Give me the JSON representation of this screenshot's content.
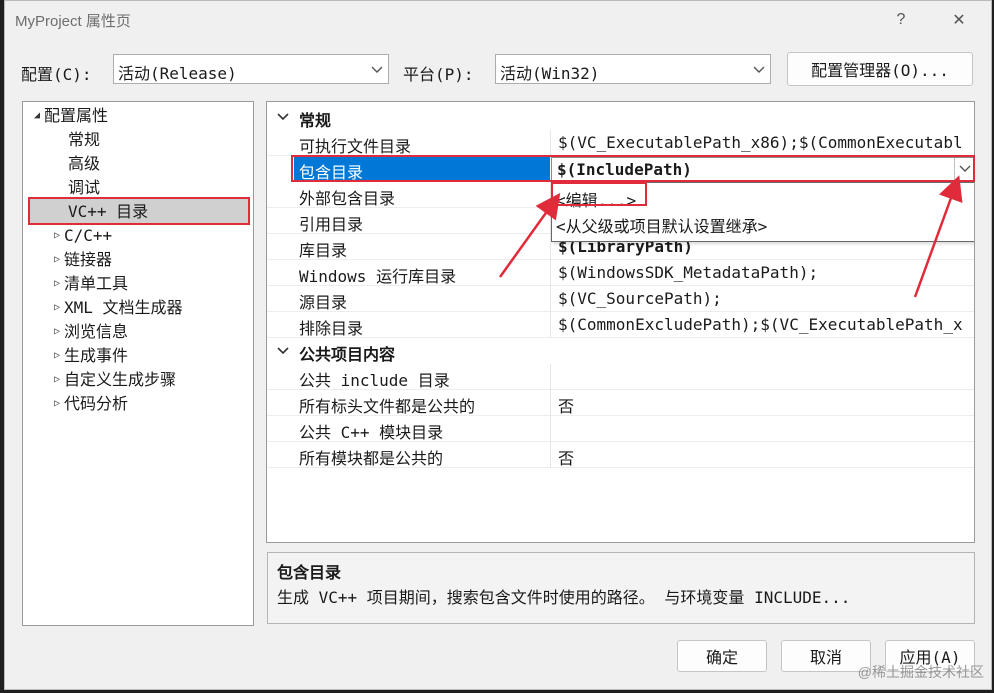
{
  "window": {
    "title": "MyProject 属性页",
    "help_glyph": "?",
    "close_glyph": "✕"
  },
  "toolbar": {
    "config_label": "配置(C):",
    "config_value": "活动(Release)",
    "platform_label": "平台(P):",
    "platform_value": "活动(Win32)",
    "config_manager_button": "配置管理器(O)..."
  },
  "tree": {
    "root": "配置属性",
    "root_toggle": "◢",
    "collapsed_toggle": "▷",
    "children": [
      "常规",
      "高级",
      "调试",
      "VC++ 目录"
    ],
    "selected": "VC++ 目录",
    "groups": [
      "C/C++",
      "链接器",
      "清单工具",
      "XML 文档生成器",
      "浏览信息",
      "生成事件",
      "自定义生成步骤",
      "代码分析"
    ]
  },
  "grid": {
    "categories": [
      {
        "name": "常规",
        "rows": [
          {
            "name": "可执行文件目录",
            "value": "$(VC_ExecutablePath_x86);$(CommonExecutabl"
          },
          {
            "name": "包含目录",
            "value": "$(IncludePath)",
            "selected": true
          },
          {
            "name": "外部包含目录",
            "value": ""
          },
          {
            "name": "引用目录",
            "value": ""
          },
          {
            "name": "库目录",
            "value": "$(LibraryPath)"
          },
          {
            "name": "Windows 运行库目录",
            "value": "$(WindowsSDK_MetadataPath);"
          },
          {
            "name": "源目录",
            "value": "$(VC_SourcePath);"
          },
          {
            "name": "排除目录",
            "value": "$(CommonExcludePath);$(VC_ExecutablePath_x"
          }
        ]
      },
      {
        "name": "公共项目内容",
        "rows": [
          {
            "name": "公共 include 目录",
            "value": ""
          },
          {
            "name": "所有标头文件都是公共的",
            "value": "否"
          },
          {
            "name": "公共 C++ 模块目录",
            "value": ""
          },
          {
            "name": "所有模块都是公共的",
            "value": "否"
          }
        ]
      }
    ],
    "dropdown_options": [
      "<编辑...>",
      "<从父级或项目默认设置继承>"
    ]
  },
  "description": {
    "title": "包含目录",
    "text": "生成 VC++ 项目期间，搜索包含文件时使用的路径。 与环境变量 INCLUDE..."
  },
  "buttons": {
    "ok": "确定",
    "cancel": "取消",
    "apply": "应用(A)"
  },
  "watermark": "@稀土掘金技术社区",
  "colors": {
    "selection_blue": "#0078d7",
    "annotation_red": "#e02b3a",
    "tree_selection_gray": "#d0d0d0"
  }
}
